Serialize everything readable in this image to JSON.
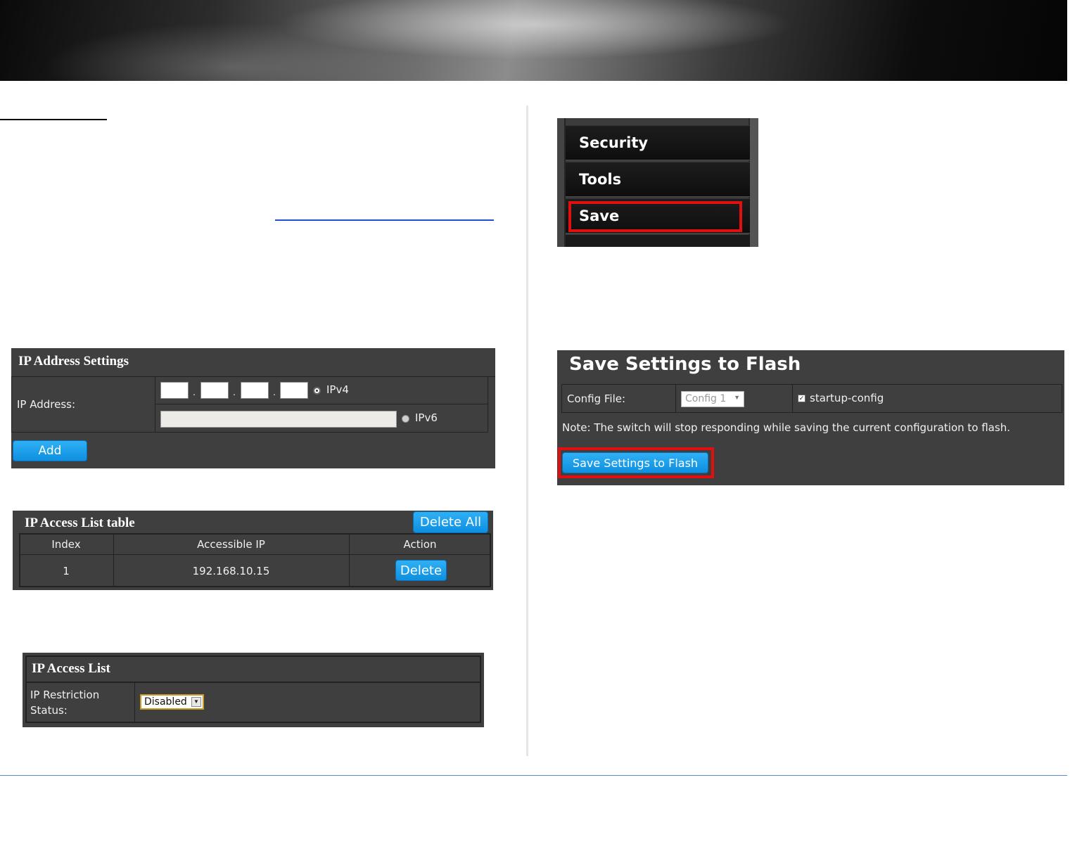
{
  "ip_address_settings": {
    "title": "IP Address Settings",
    "ip_label": "IP Address:",
    "ipv4_label": "IPv4",
    "ipv6_label": "IPv6",
    "octet_separator": ".",
    "add_label": "Add"
  },
  "ip_access_table": {
    "title": "IP Access List table",
    "delete_all_label": "Delete All",
    "columns": [
      "Index",
      "Accessible IP",
      "Action"
    ],
    "rows": [
      {
        "index": "1",
        "ip": "192.168.10.15",
        "action": "Delete"
      }
    ]
  },
  "ip_access_list": {
    "title": "IP Access List",
    "restriction_label_line1": "IP Restriction",
    "restriction_label_line2": "Status:",
    "status_value": "Disabled"
  },
  "menu": {
    "items": [
      "Security",
      "Tools",
      "Save"
    ]
  },
  "save_flash": {
    "title": "Save Settings to Flash",
    "config_label": "Config File:",
    "config_value": "Config 1",
    "checkbox_label": "startup-config",
    "note": "Note: The switch will stop responding while saving the current configuration to flash.",
    "button_label": "Save Settings to Flash"
  },
  "colors": {
    "panel_bg": "#3f3f3f",
    "button_blue": "#1aa0ec",
    "highlight_red": "#e01010"
  }
}
